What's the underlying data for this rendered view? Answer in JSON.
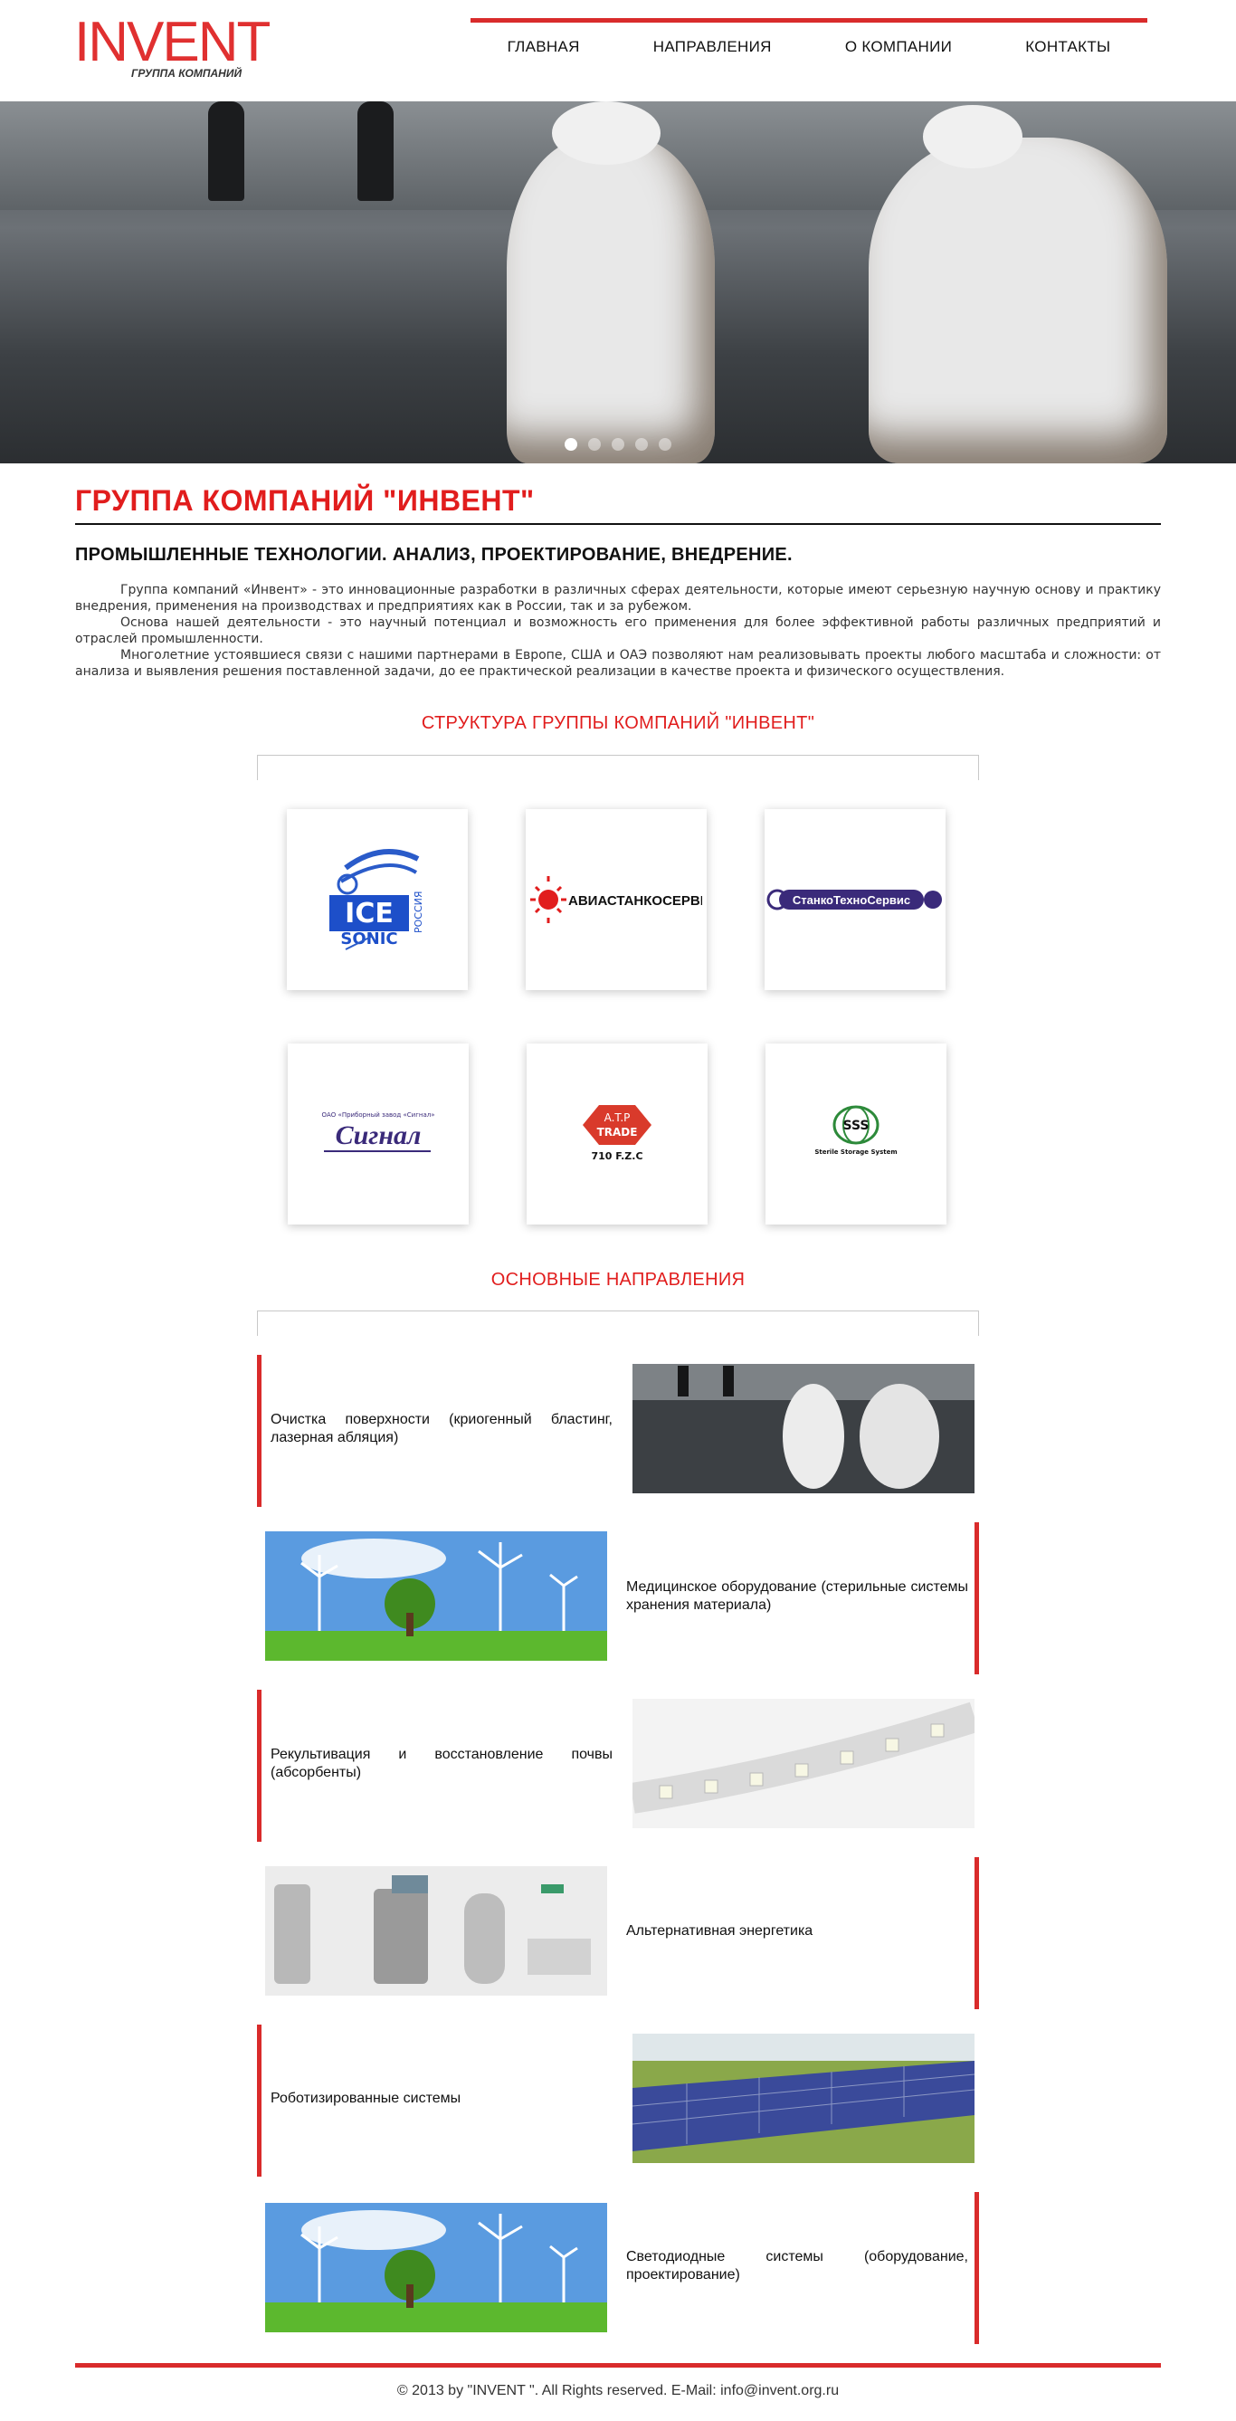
{
  "header": {
    "logo_text": "INVENT",
    "logo_sub": "ГРУППА КОМПАНИЙ",
    "nav": [
      "ГЛАВНАЯ",
      "НАПРАВЛЕНИЯ",
      "О КОМПАНИИ",
      "КОНТАКТЫ"
    ]
  },
  "hero": {
    "slides": 5,
    "active_slide": 1
  },
  "intro": {
    "title": "ГРУППА КОМПАНИЙ \"ИНВЕНТ\"",
    "subtitle": "ПРОМЫШЛЕННЫЕ ТЕХНОЛОГИИ. АНАЛИЗ, ПРОЕКТИРОВАНИЕ, ВНЕДРЕНИЕ.",
    "paragraphs": [
      "Группа компаний «Инвент» - это инновационные разработки в различных сферах деятельности, которые имеют серьезную научную основу и практику внедрения, применения на производствах и предприятиях как в России, так и за рубежом.",
      "Основа нашей деятельности - это научный потенциал и возможность его применения для более эффективной работы различных предприятий и отраслей промышленности.",
      "Многолетние устоявшиеся связи с нашими партнерами в Европе, США и ОАЭ позволяют нам реализовывать проекты любого масштаба и сложности: от анализа и выявления решения поставленной задачи, до ее практической реализации в качестве проекта и физического осуществления."
    ]
  },
  "structure": {
    "title": "СТРУКТУРА ГРУППЫ КОМПАНИЙ \"ИНВЕНТ\"",
    "logos": [
      {
        "name": "ice-sonic",
        "text_main": "ICE",
        "text_sub": "SONIC",
        "text_side": "РОССИЯ"
      },
      {
        "name": "aviastankoservis",
        "text_main": "АВИАСТАНКОСЕРВИС"
      },
      {
        "name": "stankotehservis",
        "text_main": "СтанкоТехноСервис"
      },
      {
        "name": "signal",
        "text_main": "Сигнал",
        "text_sub": "ОАО «Приборный завод «Сигнал»"
      },
      {
        "name": "atp-trade",
        "text_main": "A.T.P",
        "text_mid": "TRADE",
        "text_sub": "710 F.Z.C"
      },
      {
        "name": "sss",
        "text_main": "SSS",
        "text_sub": "Sterile Storage System"
      }
    ]
  },
  "directions": {
    "title": "ОСНОВНЫЕ НАПРАВЛЕНИЯ",
    "items": [
      {
        "label": "Очистка поверхности (криогенный бластинг, лазерная абляция)",
        "image": "oil-cleanup"
      },
      {
        "label": "Медицинское оборудование (стерильные системы хранения материала)",
        "image": "wind-turbines"
      },
      {
        "label": "Рекультивация и восстановление почвы (абсорбенты)",
        "image": "led-strip"
      },
      {
        "label": "Альтернативная энергетика",
        "image": "medical-equipment"
      },
      {
        "label": "Роботизированные системы",
        "image": "solar-panels"
      },
      {
        "label": "Светодиодные системы (оборудование, проектирование)",
        "image": "wind-turbines"
      }
    ]
  },
  "footer": {
    "text": "© 2013 by \"INVENT \". All Rights reserved. E-Mail: info@invent.org.ru"
  },
  "colors": {
    "accent": "#e11d1d",
    "bar": "#d92b2b"
  }
}
